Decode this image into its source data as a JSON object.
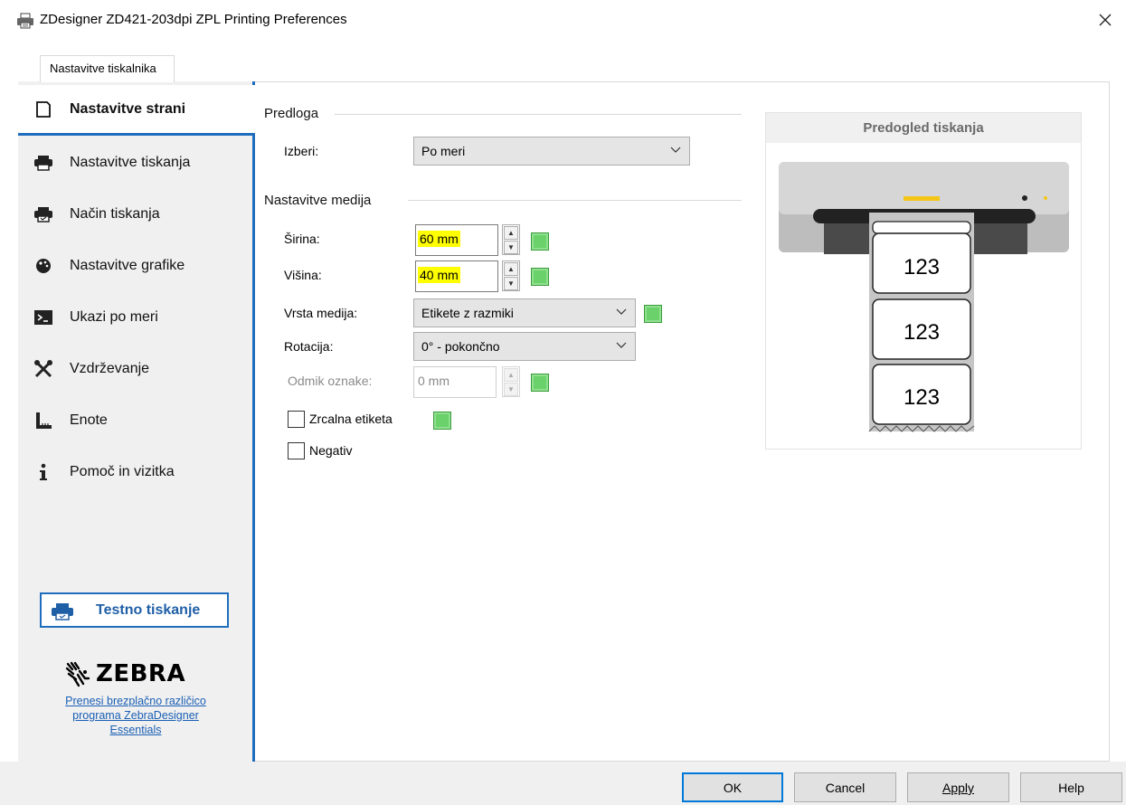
{
  "window": {
    "title": "ZDesigner ZD421-203dpi ZPL Printing Preferences",
    "icon": "printer-icon",
    "close_icon": "close-icon"
  },
  "tab": {
    "label": "Nastavitve tiskalnika"
  },
  "sidebar": {
    "items": [
      {
        "label": "Nastavitve strani",
        "icon": "page-icon",
        "active": true
      },
      {
        "label": "Nastavitve tiskanja",
        "icon": "printer-icon"
      },
      {
        "label": "Način tiskanja",
        "icon": "print-mode-icon"
      },
      {
        "label": "Nastavitve grafike",
        "icon": "graphics-icon"
      },
      {
        "label": "Ukazi po meri",
        "icon": "terminal-icon"
      },
      {
        "label": "Vzdrževanje",
        "icon": "tools-icon"
      },
      {
        "label": "Enote",
        "icon": "ruler-icon"
      },
      {
        "label": "Pomoč in vizitka",
        "icon": "info-icon"
      }
    ],
    "test_print_label": "Testno tiskanje",
    "brand": "ZEBRA",
    "download_link": [
      "Prenesi brezplačno različico",
      "programa ZebraDesigner",
      "Essentials"
    ]
  },
  "template": {
    "group_title": "Predloga",
    "select_label": "Izberi:",
    "select_value": "Po meri"
  },
  "media": {
    "group_title": "Nastavitve medija",
    "width_label": "Širina:",
    "width_value": "60 mm",
    "height_label": "Višina:",
    "height_value": "40 mm",
    "type_label": "Vrsta medija:",
    "type_value": "Etikete z razmiki",
    "rotation_label": "Rotacija:",
    "rotation_value": "0° - pokončno",
    "offset_label": "Odmik oznake:",
    "offset_value": "0 mm",
    "mirror_label": "Zrcalna etiketa",
    "mirror_checked": false,
    "negative_label": "Negativ",
    "negative_checked": false
  },
  "preview": {
    "title": "Predogled tiskanja",
    "label_text": "123"
  },
  "buttons": {
    "ok": "OK",
    "cancel": "Cancel",
    "apply": "Apply",
    "help": "Help"
  },
  "colors": {
    "accent": "#1f6dbd",
    "highlight": "#ffff00",
    "indicator": "#6bd16b"
  }
}
